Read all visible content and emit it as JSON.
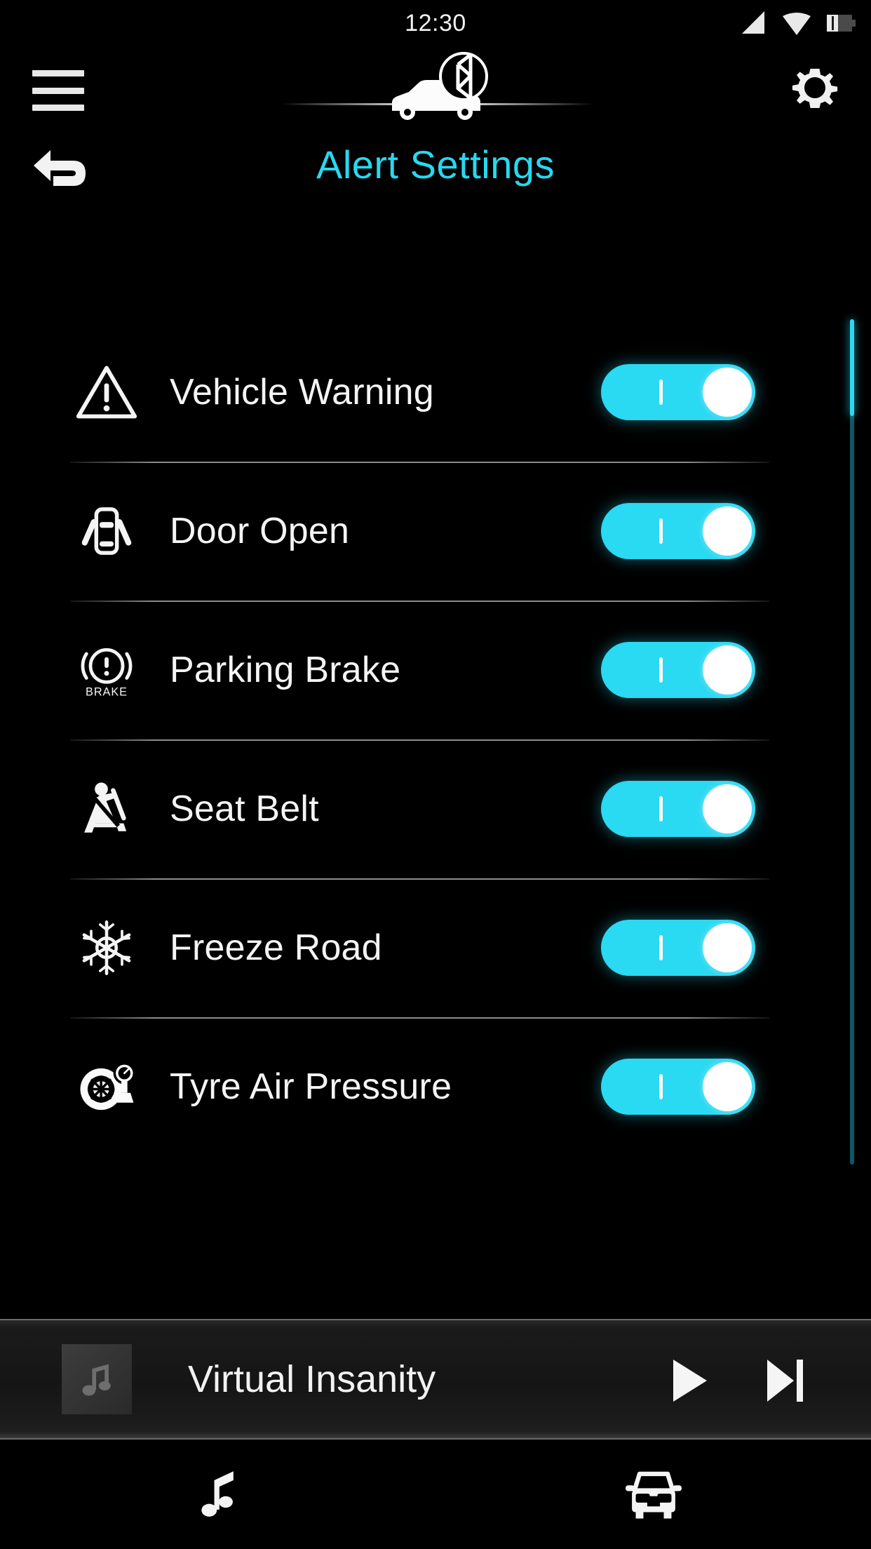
{
  "status": {
    "time": "12:30",
    "icons": [
      "cellular-signal-icon",
      "wifi-icon",
      "battery-icon"
    ]
  },
  "topbar": {
    "menu_icon": "hamburger-menu-icon",
    "connection_icon": "car-bluetooth-connection-icon",
    "settings_icon": "gear-icon"
  },
  "header": {
    "back_icon": "back-arrow-icon",
    "title": "Alert Settings",
    "title_color": "#27d8ef"
  },
  "theme": {
    "accent": "#2ad9f2",
    "background": "#000000",
    "text": "#f4f4f4"
  },
  "alerts": [
    {
      "label": "Vehicle Warning",
      "icon": "warning-triangle-icon",
      "enabled": "on"
    },
    {
      "label": "Door Open",
      "icon": "car-door-open-icon",
      "enabled": "on"
    },
    {
      "label": "Parking Brake",
      "icon": "parking-brake-icon",
      "icon_text": "BRAKE",
      "enabled": "on"
    },
    {
      "label": "Seat Belt",
      "icon": "seat-belt-icon",
      "enabled": "on"
    },
    {
      "label": "Freeze Road",
      "icon": "snowflake-icon",
      "enabled": "on"
    },
    {
      "label": "Tyre Air Pressure",
      "icon": "tyre-pressure-icon",
      "enabled": "on"
    }
  ],
  "scrollbar": {
    "thumb_position": "top"
  },
  "media": {
    "album_art_icon": "music-note-icon",
    "track_title": "Virtual Insanity",
    "play_icon": "play-icon",
    "next_icon": "next-track-icon"
  },
  "bottomnav": {
    "items": [
      {
        "icon": "music-note-icon"
      },
      {
        "icon": "car-front-icon"
      }
    ]
  }
}
